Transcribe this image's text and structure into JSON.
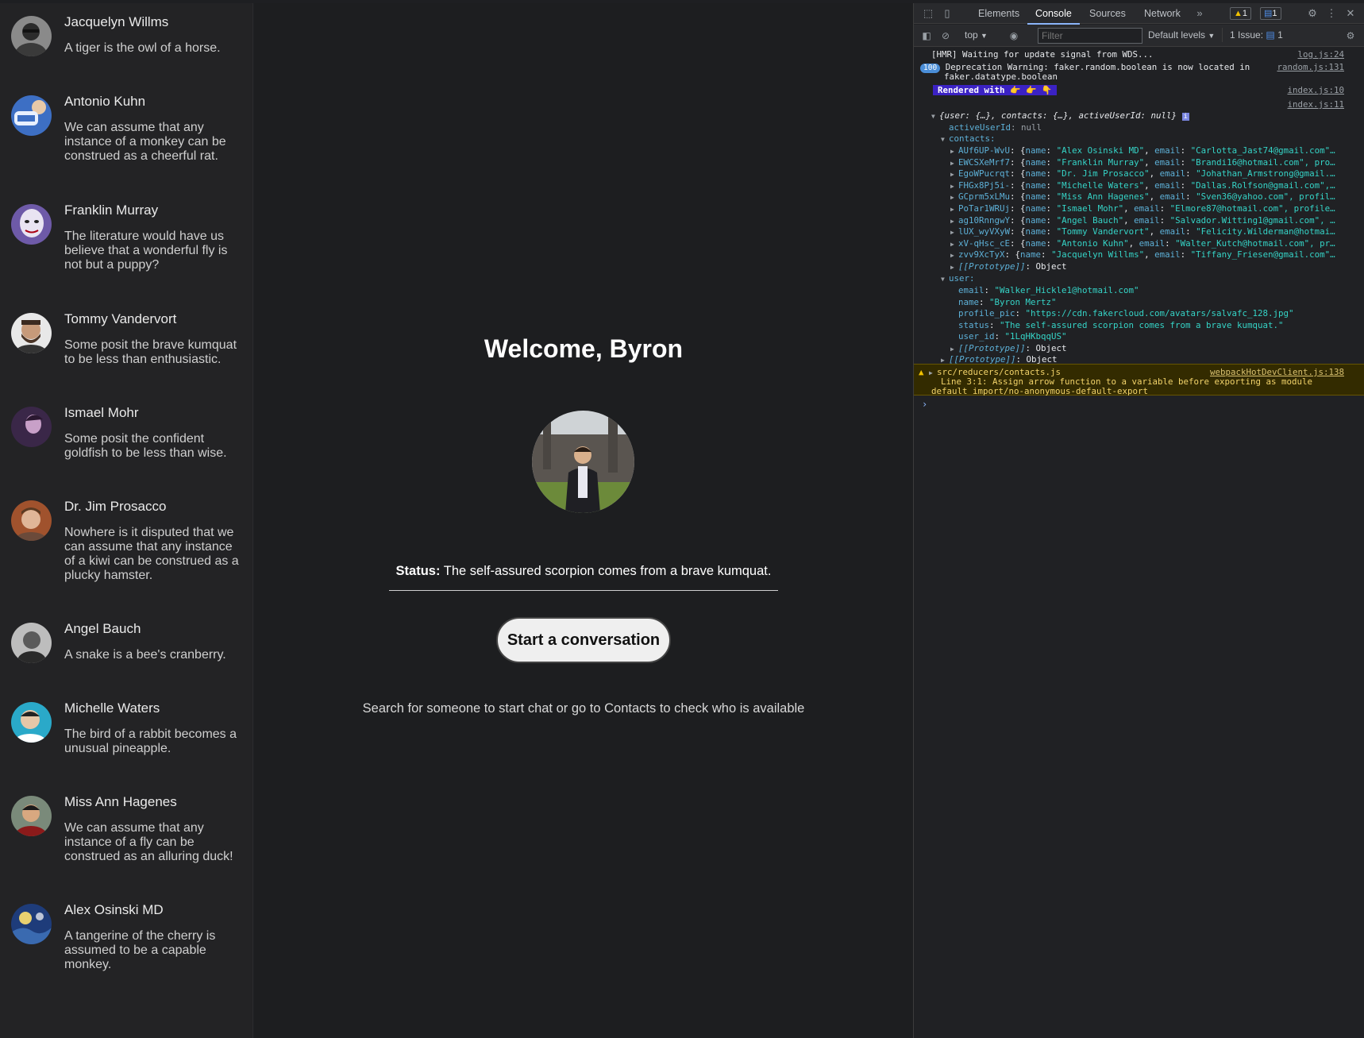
{
  "contacts": [
    {
      "name": "Jacquelyn Willms",
      "status": "A tiger is the owl of a horse."
    },
    {
      "name": "Antonio Kuhn",
      "status": "We can assume that any instance of a monkey can be construed as a cheerful rat."
    },
    {
      "name": "Franklin Murray",
      "status": "The literature would have us believe that a wonderful fly is not but a puppy?"
    },
    {
      "name": "Tommy Vandervort",
      "status": "Some posit the brave kumquat to be less than enthusiastic."
    },
    {
      "name": "Ismael Mohr",
      "status": "Some posit the confident goldfish to be less than wise."
    },
    {
      "name": "Dr. Jim Prosacco",
      "status": "Nowhere is it disputed that we can assume that any instance of a kiwi can be construed as a plucky hamster."
    },
    {
      "name": "Angel Bauch",
      "status": "A snake is a bee's cranberry."
    },
    {
      "name": "Michelle Waters",
      "status": "The bird of a rabbit becomes a unusual pineapple."
    },
    {
      "name": "Miss Ann Hagenes",
      "status": "We can assume that any instance of a fly can be construed as an alluring duck!"
    },
    {
      "name": "Alex Osinski MD",
      "status": "A tangerine of the cherry is assumed to be a capable monkey."
    }
  ],
  "main": {
    "welcome": "Welcome, Byron",
    "status_label": "Status:",
    "status_text": "The self-assured scorpion comes from a brave kumquat.",
    "start_button": "Start a conversation",
    "hint": "Search for someone to start chat or go to Contacts to check who is available"
  },
  "devtools": {
    "tabs": [
      "Elements",
      "Console",
      "Sources",
      "Network"
    ],
    "active_tab": "Console",
    "warn_count": "1",
    "msg_count": "1",
    "context": "top",
    "filter_placeholder": "Filter",
    "levels": "Default levels",
    "issues": "1 Issue:",
    "issues_count": "1",
    "logs": {
      "hmr": "[HMR] Waiting for update signal from WDS...",
      "hmr_src": "log.js:24",
      "dep_count": "100",
      "dep_line1": "Deprecation Warning: faker.random.boolean is now located in",
      "dep_line2": "faker.datatype.boolean",
      "dep_src": "random.js:131",
      "rendered": "Rendered with 👉 👉 👇",
      "rendered_src": "index.js:10",
      "obj_src": "index.js:11",
      "obj_summary": "{user: {…}, contacts: {…}, activeUserId: null}",
      "activeUserId_key": "activeUserId",
      "activeUserId_val": "null",
      "contacts_key": "contacts:",
      "contact_entries": [
        {
          "key": "AUf6UP-WvU",
          "name": "\"Alex Osinski MD\"",
          "email": "\"Carlotta_Jast74@gmail.com\"…"
        },
        {
          "key": "EWCSXeMrf7",
          "name": "\"Franklin Murray\"",
          "email": "\"Brandi16@hotmail.com\", pro…"
        },
        {
          "key": "EgoWPucrqt",
          "name": "\"Dr. Jim Prosacco\"",
          "email": "\"Johathan_Armstrong@gmail.…"
        },
        {
          "key": "FHGx8Pj5i-",
          "name": "\"Michelle Waters\"",
          "email": "\"Dallas.Rolfson@gmail.com\",…"
        },
        {
          "key": "GCprm5xLMu",
          "name": "\"Miss Ann Hagenes\"",
          "email": "\"Sven36@yahoo.com\", profil…"
        },
        {
          "key": "PoTar1WRUj",
          "name": "\"Ismael Mohr\"",
          "email": "\"Elmore87@hotmail.com\", profile…"
        },
        {
          "key": "ag10RnngwY",
          "name": "\"Angel Bauch\"",
          "email": "\"Salvador.Witting1@gmail.com\", …"
        },
        {
          "key": "lUX_wyVXyW",
          "name": "\"Tommy Vandervort\"",
          "email": "\"Felicity.Wilderman@hotmai…"
        },
        {
          "key": "xV-qHsc_cE",
          "name": "\"Antonio Kuhn\"",
          "email": "\"Walter_Kutch@hotmail.com\", pr…"
        },
        {
          "key": "zvv9XcTyX",
          "name": "\"Jacquelyn Willms\"",
          "email": "\"Tiffany_Friesen@gmail.com\"…"
        }
      ],
      "prototype": "[[Prototype]]",
      "object": "Object",
      "user_key": "user:",
      "user_fields": [
        {
          "key": "email",
          "val": "\"Walker_Hickle1@hotmail.com\""
        },
        {
          "key": "name",
          "val": "\"Byron Mertz\""
        },
        {
          "key": "profile_pic",
          "val": "\"https://cdn.fakercloud.com/avatars/salvafc_128.jpg\""
        },
        {
          "key": "status",
          "val": "\"The self-assured scorpion comes from a brave kumquat.\""
        },
        {
          "key": "user_id",
          "val": "\"1LqHKbqqUS\""
        }
      ],
      "warn_file": "src/reducers/contacts.js",
      "warn_src": "webpackHotDevClient.js:138",
      "warn_line1": "Line 3:1:  Assign arrow function to a variable before exporting as module",
      "warn_line2": "default  import/no-anonymous-default-export"
    }
  },
  "colors": {
    "sidebar_bg": "#232325",
    "main_bg": "#1d1e20",
    "devtools_bg": "#202124",
    "string": "#35d4c7",
    "key": "#5db0d7",
    "warning_bg": "#332b00"
  }
}
